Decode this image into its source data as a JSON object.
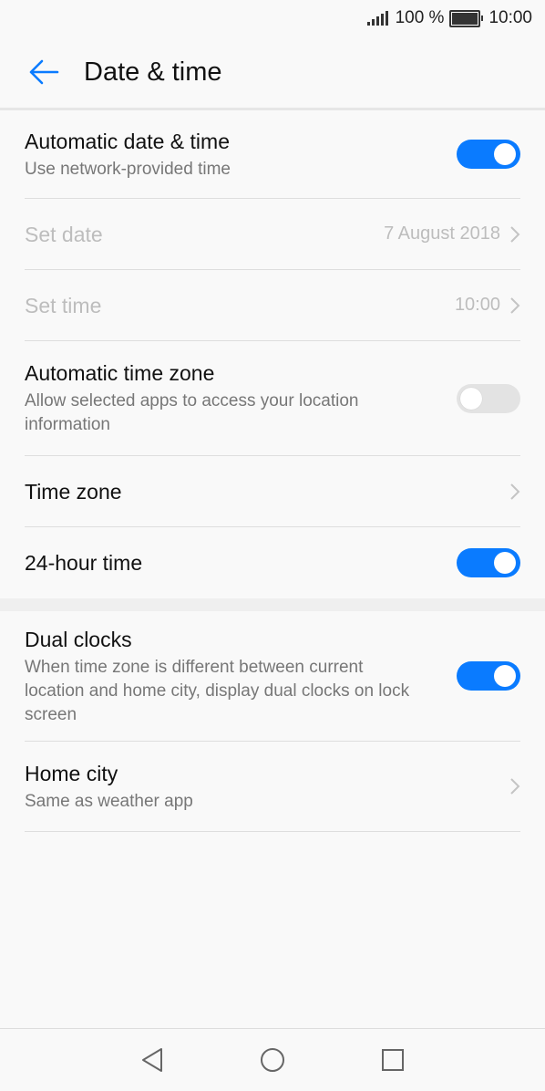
{
  "status_bar": {
    "battery_text": "100 %",
    "time": "10:00"
  },
  "header": {
    "title": "Date & time",
    "back_icon": "arrow-left-icon"
  },
  "settings": {
    "automatic_date_time": {
      "label": "Automatic date & time",
      "summary": "Use network-provided time",
      "enabled": true
    },
    "set_date": {
      "label": "Set date",
      "value": "7 August 2018"
    },
    "set_time": {
      "label": "Set time",
      "value": "10:00"
    },
    "automatic_time_zone": {
      "label": "Automatic time zone",
      "summary": "Allow selected apps to access your location information",
      "enabled": false
    },
    "time_zone": {
      "label": "Time zone"
    },
    "hour24": {
      "label": "24-hour time",
      "enabled": true
    },
    "dual_clocks": {
      "label": "Dual clocks",
      "summary": "When time zone is different between current location and home city, display dual clocks on lock screen",
      "enabled": true
    },
    "home_city": {
      "label": "Home city",
      "summary": "Same as weather app"
    }
  },
  "colors": {
    "accent": "#0a7bff",
    "disabled_text": "#bdbdbd",
    "toggle_off": "#e3e3e3"
  },
  "nav_bar": {
    "icons": [
      "back-triangle-icon",
      "home-circle-icon",
      "recents-square-icon"
    ]
  }
}
